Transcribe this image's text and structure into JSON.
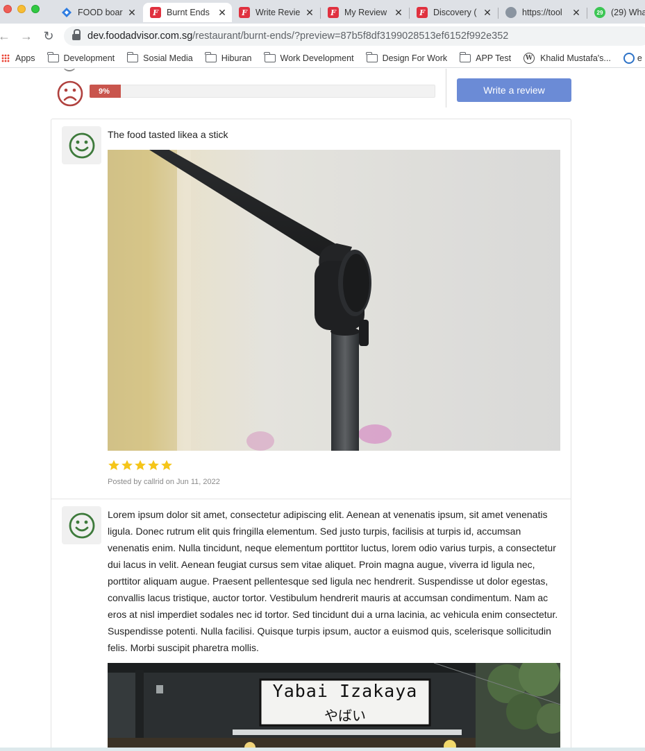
{
  "browser": {
    "tabs": [
      {
        "title": "FOOD boar",
        "icon": "jira-diamond-icon",
        "active": false
      },
      {
        "title": "Burnt Ends",
        "icon": "foodadvisor-icon",
        "active": true
      },
      {
        "title": "Write Revie",
        "icon": "foodadvisor-icon",
        "active": false
      },
      {
        "title": "My Review",
        "icon": "foodadvisor-icon",
        "active": false
      },
      {
        "title": "Discovery (",
        "icon": "foodadvisor-icon",
        "active": false
      },
      {
        "title": "https://tool",
        "icon": "globe-icon",
        "active": false
      },
      {
        "title": "(29) Wha",
        "icon": "whatsapp-icon",
        "active": false,
        "badge": "29"
      }
    ],
    "url_domain": "dev.foodadvisor.com.sg",
    "url_path": "/restaurant/burnt-ends/?preview=87b5f8df3199028513ef6152f992e352",
    "bookmarks": [
      "Apps",
      "Development",
      "Sosial Media",
      "Hiburan",
      "Work Development",
      "Design For Work",
      "APP Test",
      "Khalid Mustafa's...",
      "e"
    ]
  },
  "rating_summary": {
    "negative_percent_label": "9%",
    "negative_fraction": 0.09,
    "write_review_label": "Write a review"
  },
  "reviews": [
    {
      "sentiment": "happy",
      "text": "The food tasted likea a stick",
      "stars": 5,
      "posted": "Posted by callrid on Jun 11, 2022"
    },
    {
      "sentiment": "happy",
      "text": "Lorem ipsum dolor sit amet, consectetur adipiscing elit. Aenean at venenatis ipsum, sit amet venenatis ligula. Donec rutrum elit quis fringilla elementum. Sed justo turpis, facilisis at turpis id, accumsan venenatis enim. Nulla tincidunt, neque elementum porttitor luctus, lorem odio varius turpis, a consectetur dui lacus in velit. Aenean feugiat cursus sem vitae aliquet. Proin magna augue, viverra id ligula nec, porttitor aliquam augue. Praesent pellentesque sed ligula nec hendrerit. Suspendisse ut dolor egestas, convallis lacus tristique, auctor tortor. Vestibulum hendrerit mauris at accumsan condimentum. Nam ac eros at nisl imperdiet sodales nec id tortor. Sed tincidunt dui a urna lacinia, ac vehicula enim consectetur. Suspendisse potenti. Nulla facilisi. Quisque turpis ipsum, auctor a euismod quis, scelerisque sollicitudin felis. Morbi suscipit pharetra mollis.",
      "photo_sign_line1": "Yabai Izakaya",
      "photo_sign_line2": "やばい"
    }
  ],
  "colors": {
    "sad": "#b0413e",
    "happy": "#3d7a3b",
    "bar": "#c9554d",
    "button": "#6b8bd6",
    "star": "#f5c518"
  }
}
